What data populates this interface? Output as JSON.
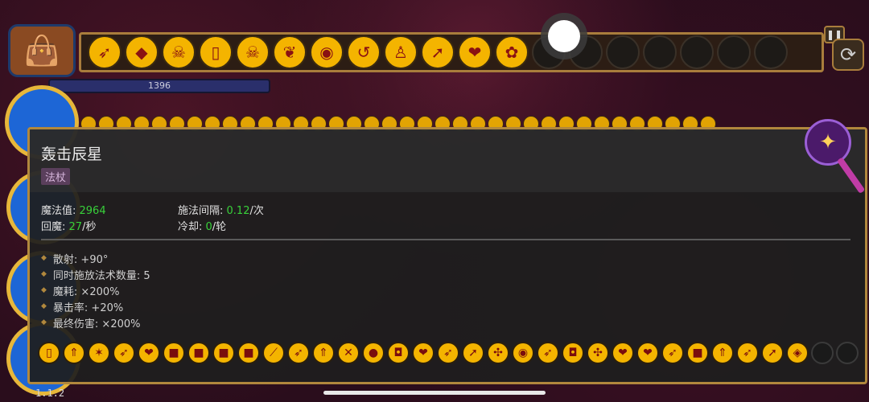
{
  "hud": {
    "hp_value": "1396",
    "version": "1.1.2",
    "top_slots": [
      {
        "icon": "crossed-arrows-icon",
        "glyph": "➶",
        "filled": true
      },
      {
        "icon": "pink-crystal-icon",
        "glyph": "◆",
        "filled": true
      },
      {
        "icon": "green-skull-icon",
        "glyph": "☠",
        "filled": true
      },
      {
        "icon": "mouse-icon",
        "glyph": "▯",
        "filled": true
      },
      {
        "icon": "green-skull-icon",
        "glyph": "☠",
        "filled": true
      },
      {
        "icon": "larva-icon",
        "glyph": "❦",
        "filled": true
      },
      {
        "icon": "eye-icon",
        "glyph": "◉",
        "filled": true
      },
      {
        "icon": "boomerang-icon",
        "glyph": "↺",
        "filled": true
      },
      {
        "icon": "shield-figure-icon",
        "glyph": "♙",
        "filled": true
      },
      {
        "icon": "arc-arrow-icon",
        "glyph": "➚",
        "filled": true
      },
      {
        "icon": "flesh-icon",
        "glyph": "❤",
        "filled": true
      },
      {
        "icon": "brain-icon",
        "glyph": "✿",
        "filled": true
      },
      {
        "icon": "empty-slot-icon",
        "glyph": "",
        "filled": false
      },
      {
        "icon": "empty-slot-icon",
        "glyph": "",
        "filled": false
      },
      {
        "icon": "empty-slot-icon",
        "glyph": "",
        "filled": false
      },
      {
        "icon": "empty-slot-icon",
        "glyph": "",
        "filled": false
      },
      {
        "icon": "empty-slot-icon",
        "glyph": "",
        "filled": false
      },
      {
        "icon": "empty-slot-icon",
        "glyph": "",
        "filled": false
      },
      {
        "icon": "empty-slot-icon",
        "glyph": "",
        "filled": false
      }
    ]
  },
  "tooltip": {
    "name": "轰击辰星",
    "type": "法杖",
    "mana_label": "魔法值: ",
    "mana_value": "2964",
    "cast_interval_label": "施法间隔: ",
    "cast_interval_value": "0.12",
    "cast_interval_unit": "/次",
    "regen_label": "回魔: ",
    "regen_value": "27",
    "regen_unit": "/秒",
    "cooldown_label": "冷却: ",
    "cooldown_value": "0",
    "cooldown_unit": "/轮",
    "modifiers": [
      "散射: +90°",
      "同时施放法术数量: 5",
      "魔耗: ×200%",
      "暴击率: +20%",
      "最终伤害: ×200%"
    ],
    "spells": [
      {
        "icon": "mouse-icon",
        "glyph": "▯"
      },
      {
        "icon": "double-arrow-up-icon",
        "glyph": "⇑"
      },
      {
        "icon": "blue-scatter-icon",
        "glyph": "✶"
      },
      {
        "icon": "crossed-arrows-icon",
        "glyph": "➶"
      },
      {
        "icon": "flesh-icon",
        "glyph": "❤"
      },
      {
        "icon": "pink-cube-icon",
        "glyph": "■"
      },
      {
        "icon": "pink-cube-icon",
        "glyph": "■"
      },
      {
        "icon": "pink-cube-icon",
        "glyph": "■"
      },
      {
        "icon": "pink-cube-icon",
        "glyph": "■"
      },
      {
        "icon": "slash-icon",
        "glyph": "⟋"
      },
      {
        "icon": "crossed-arrows-icon",
        "glyph": "➶"
      },
      {
        "icon": "double-arrow-up-icon",
        "glyph": "⇑"
      },
      {
        "icon": "crossed-bow-icon",
        "glyph": "✕"
      },
      {
        "icon": "globe-icon",
        "glyph": "●"
      },
      {
        "icon": "pot-icon",
        "glyph": "◘"
      },
      {
        "icon": "flesh-icon",
        "glyph": "❤"
      },
      {
        "icon": "crossed-arrows-icon",
        "glyph": "➶"
      },
      {
        "icon": "arc-arrow-icon",
        "glyph": "➚"
      },
      {
        "icon": "triple-burst-icon",
        "glyph": "✣"
      },
      {
        "icon": "eye-icon",
        "glyph": "◉"
      },
      {
        "icon": "crossed-arrows-icon",
        "glyph": "➶"
      },
      {
        "icon": "pot-icon",
        "glyph": "◘"
      },
      {
        "icon": "triple-burst-icon",
        "glyph": "✣"
      },
      {
        "icon": "flesh-icon",
        "glyph": "❤"
      },
      {
        "icon": "flesh-icon",
        "glyph": "❤"
      },
      {
        "icon": "crossed-arrows-icon",
        "glyph": "➶"
      },
      {
        "icon": "pink-cube-icon",
        "glyph": "■"
      },
      {
        "icon": "double-arrow-up-icon",
        "glyph": "⇑"
      },
      {
        "icon": "crossed-arrows-icon",
        "glyph": "➶"
      },
      {
        "icon": "arc-arrow-icon",
        "glyph": "➚"
      },
      {
        "icon": "teal-gem-icon",
        "glyph": "◈"
      },
      {
        "icon": "empty-slot-icon",
        "glyph": "",
        "empty": true
      },
      {
        "icon": "empty-slot-icon",
        "glyph": "",
        "empty": true
      }
    ]
  }
}
